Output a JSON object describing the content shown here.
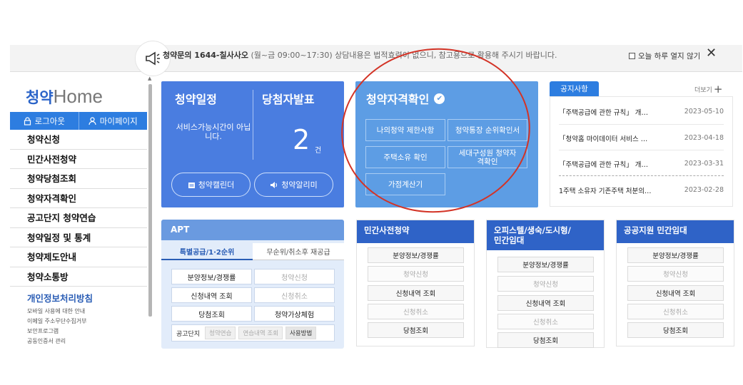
{
  "notice_bar": {
    "hotline": "청약문의 1644-칠사사오",
    "hours": "(월~금 09:00~17:30)",
    "disclaimer": "상담내용은 법적효력이 없으니, 참고용으로 활용해 주시기 바랍니다.",
    "today_close": "오늘 하루 열지 않기"
  },
  "sidebar": {
    "logo_k": "청약",
    "logo_h": "Home",
    "logout": "로그아웃",
    "mypage": "마이페이지",
    "menu": [
      "청약신청",
      "민간사전청약",
      "청약당첨조회",
      "청약자격확인",
      "공고단지 청약연습",
      "청약일정 및 통계",
      "청약제도안내",
      "청약소통방"
    ],
    "privacy": "개인정보처리방침",
    "sublinks": [
      "모바일 사용에 대한 안내",
      "이메일 주소무단수집거부",
      "보안프로그램",
      "공동인증서 관리"
    ]
  },
  "schedule_panel": {
    "title": "청약일정",
    "winner_title": "당첨자발표",
    "message": "서비스가능시간이 아닙니다.",
    "count": "2",
    "unit": "건",
    "calendar_btn": "청약캘린더",
    "alarm_btn": "청약알리미"
  },
  "eligibility_panel": {
    "title": "청약자격확인",
    "buttons": [
      "나의청약 제한사항",
      "청약통장 순위확인서",
      "주택소유 확인",
      "세대구성원 청약자격확인",
      "가점계산기"
    ]
  },
  "notices": {
    "tab": "공지사항",
    "more": "더보기",
    "items": [
      {
        "title": "「주택공급에 관한 규칙」 개…",
        "date": "2023-05-10"
      },
      {
        "title": "「청약홈 마이데이터 서비스 …",
        "date": "2023-04-18"
      },
      {
        "title": "「주택공급에 관한 규칙」 개…",
        "date": "2023-03-31"
      },
      {
        "title": "1주택 소유자 기존주택 처분의…",
        "date": "2023-02-28"
      }
    ]
  },
  "apt": {
    "title": "APT",
    "tab_active": "특별공급/1·2순위",
    "tab_inactive": "무순위/취소후 재공급",
    "buttons": [
      "분양정보/경쟁률",
      "청약신청",
      "신청내역 조회",
      "신청취소",
      "당첨조회",
      "청약가상체험"
    ],
    "row_label": "공고단지",
    "row_buttons": [
      "청약연습",
      "연습내역 조회",
      "사용방법"
    ]
  },
  "categories": [
    {
      "title": "민간사전청약",
      "buttons": [
        "분양정보/경쟁률",
        "청약신청",
        "신청내역 조회",
        "신청취소",
        "당첨조회"
      ]
    },
    {
      "title": "오피스텔/생숙/도시형/\n민간임대",
      "buttons": [
        "분양정보/경쟁률",
        "청약신청",
        "신청내역 조회",
        "신청취소",
        "당첨조회"
      ]
    },
    {
      "title": "공공지원 민간임대",
      "buttons": [
        "분양정보/경쟁률",
        "청약신청",
        "신청내역 조회",
        "신청취소",
        "당첨조회"
      ]
    }
  ],
  "colors": {
    "primary": "#2d7de0",
    "panel_dark": "#4a7de0",
    "panel_light": "#5d9de4",
    "annotation": "#d33326"
  }
}
